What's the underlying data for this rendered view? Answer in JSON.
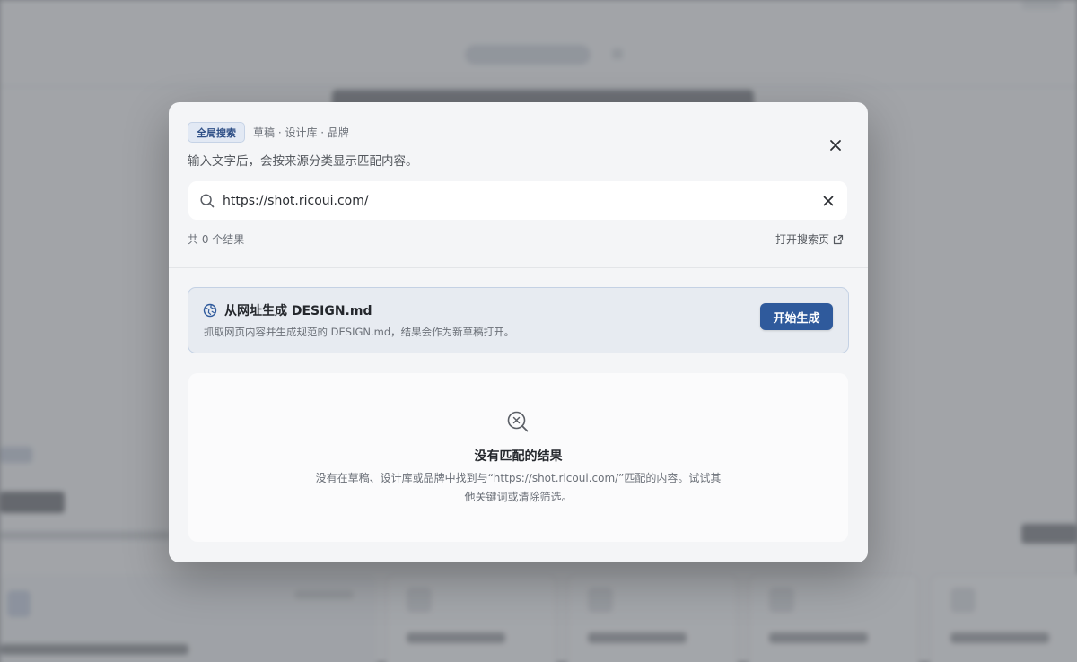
{
  "modal": {
    "scope_badge": "全局搜索",
    "scope_sources": "草稿 · 设计库 · 品牌",
    "hint": "输入文字后，会按来源分类显示匹配内容。",
    "close_icon": "close-icon"
  },
  "search": {
    "value": "https://shot.ricoui.com/",
    "search_icon": "search-icon",
    "clear_icon": "clear-icon"
  },
  "results": {
    "count_text": "共 0 个结果",
    "open_page_label": "打开搜索页",
    "open_page_icon": "external-link-icon"
  },
  "generate": {
    "icon": "globe-icon",
    "title": "从网址生成 DESIGN.md",
    "description": "抓取网页内容并生成规范的 DESIGN.md，结果会作为新草稿打开。",
    "button_label": "开始生成"
  },
  "empty_state": {
    "icon": "search-x-icon",
    "title": "没有匹配的结果",
    "description": "没有在草稿、设计库或品牌中找到与“https://shot.ricoui.com/”匹配的内容。试试其他关键词或清除筛选。"
  },
  "colors": {
    "accent": "#2f5a9c",
    "badge_bg": "#e2e9f4",
    "badge_text": "#2e4f86",
    "card_bg": "#e7ebf1"
  }
}
